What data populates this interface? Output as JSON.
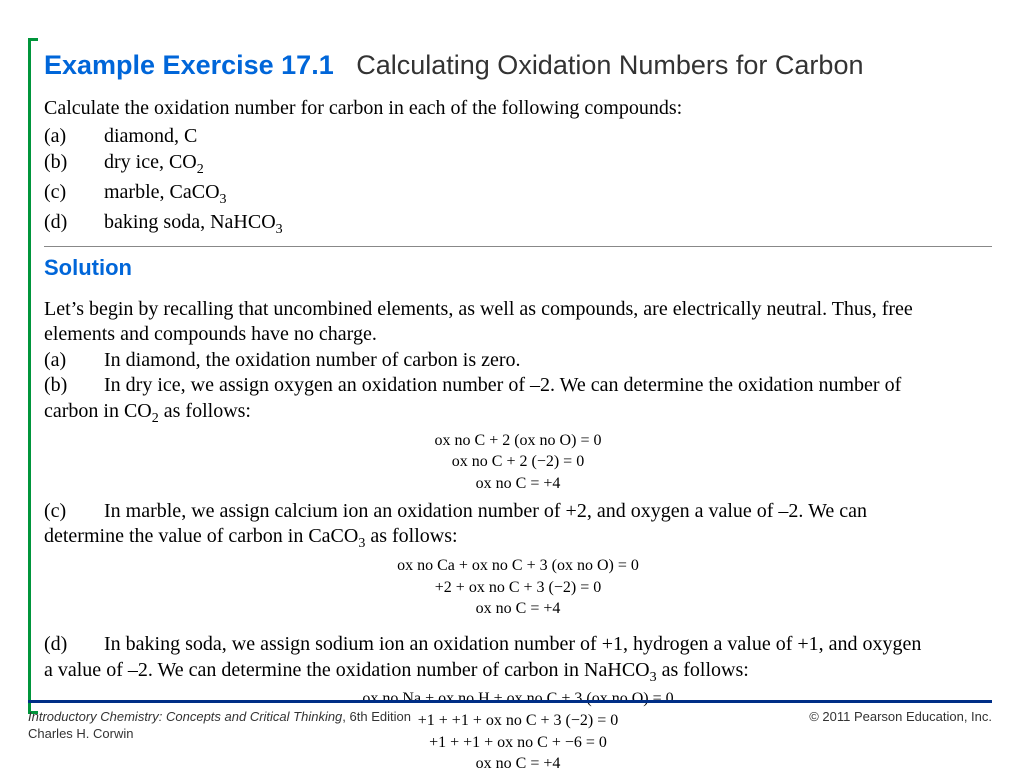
{
  "title": {
    "label": "Example Exercise 17.1",
    "text": "Calculating Oxidation Numbers for Carbon"
  },
  "prompt": "Calculate the oxidation number for carbon in each of the following compounds:",
  "options": {
    "a": {
      "lbl": "(a)",
      "text": "diamond, C"
    },
    "b": {
      "lbl": "(b)",
      "pre": "dry ice, CO",
      "sub": "2"
    },
    "c": {
      "lbl": "(c)",
      "pre": "marble, CaCO",
      "sub": "3"
    },
    "d": {
      "lbl": "(d)",
      "pre": "baking soda, NaHCO",
      "sub": "3"
    }
  },
  "solution_hd": "Solution",
  "sol": {
    "intro1": "Let’s begin by recalling that uncombined elements, as well as compounds, are electrically neutral. Thus, free",
    "intro2": "elements and compounds have no charge.",
    "a_lbl": "(a)",
    "a_txt": "In diamond, the oxidation number of carbon is zero.",
    "b_lbl": "(b)",
    "b_txt1": "In dry ice, we assign oxygen an oxidation number of –2. We can determine the oxidation number of",
    "b_txt2_pre": "carbon in CO",
    "b_txt2_sub": "2",
    "b_txt2_post": " as follows:",
    "b_math": [
      "ox no C + 2 (ox no O) = 0",
      "ox no C + 2 (−2) = 0",
      "ox no C = +4"
    ],
    "c_lbl": "(c)",
    "c_txt1": "In marble, we assign calcium ion an oxidation number of +2, and oxygen a value of –2. We can",
    "c_txt2_pre": "determine the value of carbon in CaCO",
    "c_txt2_sub": "3",
    "c_txt2_post": " as follows:",
    "c_math": [
      "ox no Ca + ox no C + 3 (ox no O) = 0",
      "+2 + ox no C + 3 (−2) = 0",
      "ox no C = +4"
    ],
    "d_lbl": "(d)",
    "d_txt1": "In baking soda, we assign sodium ion an oxidation number of +1, hydrogen a value of +1, and oxygen",
    "d_txt2_pre": "a value of –2. We can determine the oxidation number of carbon in NaHCO",
    "d_txt2_sub": "3",
    "d_txt2_post": " as follows:",
    "d_math": [
      "ox no Na + ox no H + ox no C + 3 (ox no O) = 0",
      "+1 + +1 + ox no C + 3 (−2) = 0",
      "+1 + +1 + ox no C + −6 = 0",
      "ox no C = +4"
    ]
  },
  "footer": {
    "book_title": "Introductory Chemistry: Concepts and Critical Thinking",
    "edition": ", 6th Edition",
    "copyright": "© 2011 Pearson Education, Inc.",
    "author": "Charles H. Corwin"
  }
}
